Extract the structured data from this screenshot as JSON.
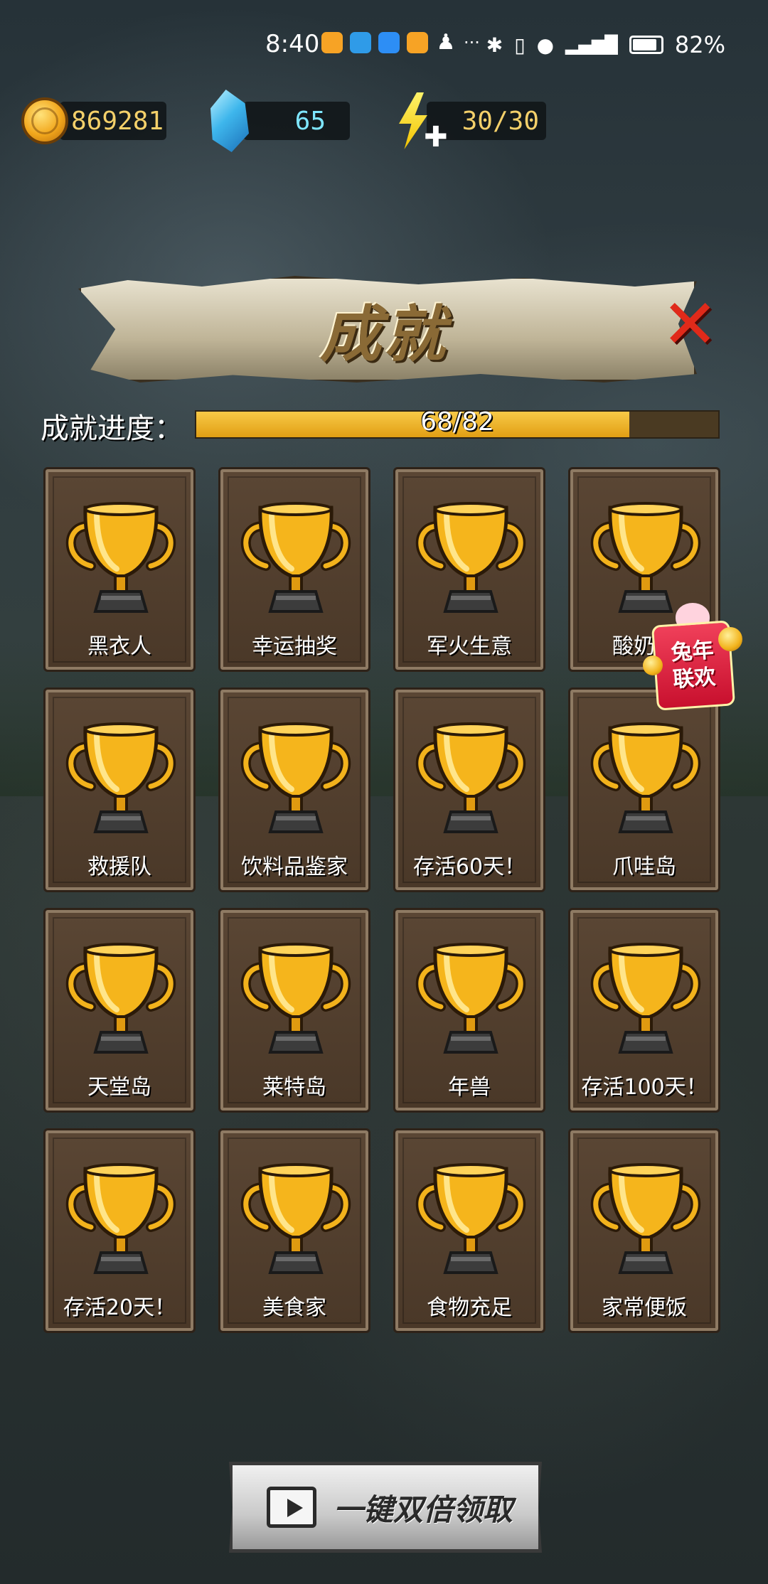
{
  "status_bar": {
    "time": "8:40",
    "battery": "82%",
    "app_icon_colors": [
      "#f7a325",
      "#2f9be8",
      "#2d8ef5",
      "#f7a325"
    ],
    "glyphs": [
      "qq-icon",
      "more-icon",
      "bluetooth-icon",
      "vibrate-icon",
      "location-icon",
      "signal-5g-icon",
      "battery-icon"
    ],
    "more_glyph": "···"
  },
  "resources": {
    "gold": "869281",
    "gems": "65",
    "energy": "30/30"
  },
  "title": "成就",
  "progress": {
    "label": "成就进度：",
    "text": "68/82",
    "fraction": 0.8293
  },
  "achievements": [
    {
      "name": "黑衣人"
    },
    {
      "name": "幸运抽奖"
    },
    {
      "name": "军火生意"
    },
    {
      "name": "酸奶爱"
    },
    {
      "name": "救援队"
    },
    {
      "name": "饮料品鉴家"
    },
    {
      "name": "存活60天！"
    },
    {
      "name": "爪哇岛"
    },
    {
      "name": "天堂岛"
    },
    {
      "name": "莱特岛"
    },
    {
      "name": "年兽"
    },
    {
      "name": "存活100天！"
    },
    {
      "name": "存活20天！"
    },
    {
      "name": "美食家"
    },
    {
      "name": "食物充足"
    },
    {
      "name": "家常便饭"
    }
  ],
  "promo": {
    "line1": "兔年",
    "line2": "联欢"
  },
  "claim_button": {
    "label": "一键双倍领取"
  },
  "colors": {
    "trophy_gold": "#f5b51c",
    "card_bg": "#4f3c2c",
    "progress_fill": "#f0b22c"
  }
}
